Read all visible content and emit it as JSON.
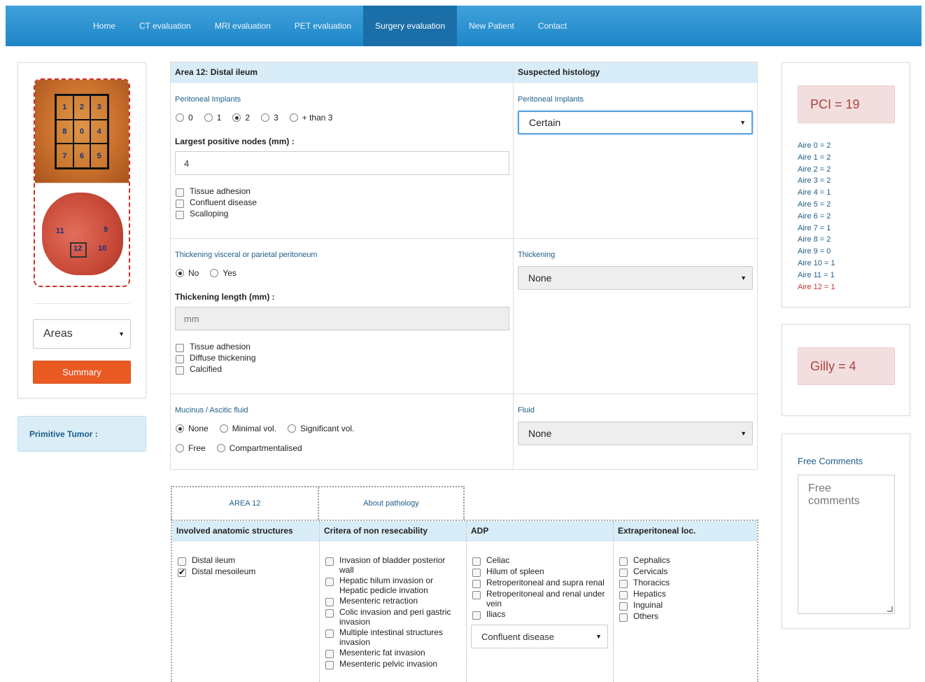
{
  "nav": {
    "items": [
      "Home",
      "CT evaluation",
      "MRI evaluation",
      "PET evaluation",
      "Surgery evaluation",
      "New Patient",
      "Contact"
    ],
    "active": "Surgery evaluation"
  },
  "left": {
    "areas_select": "Areas",
    "summary_button": "Summary",
    "primitive_tumor": "Primitive Tumor :",
    "abdomen_regions": [
      "1",
      "2",
      "3",
      "8",
      "0",
      "4",
      "7",
      "6",
      "5"
    ],
    "intestine_regions": [
      "11",
      "9",
      "12",
      "10"
    ]
  },
  "form": {
    "area_title": "Area 12: Distal ileum",
    "histology_title": "Suspected histology",
    "implants": {
      "label": "Peritoneal Implants",
      "options": [
        "0",
        "1",
        "2",
        "3",
        "+ than 3"
      ],
      "selected": "2",
      "nodes_label": "Largest positive nodes (mm) :",
      "nodes_value": "4",
      "checks": [
        {
          "label": "Tissue adhesion",
          "checked": false
        },
        {
          "label": "Confluent disease",
          "checked": false
        },
        {
          "label": "Scalloping",
          "checked": false
        }
      ],
      "hist_label": "Peritoneal Implants",
      "hist_value": "Certain"
    },
    "thickening": {
      "label": "Thickening visceral or parietal peritoneum",
      "options": [
        "No",
        "Yes"
      ],
      "selected": "No",
      "length_label": "Thickening length (mm) :",
      "length_placeholder": "mm",
      "checks": [
        {
          "label": "Tissue adhesion",
          "checked": false
        },
        {
          "label": "Diffuse thickening",
          "checked": false
        },
        {
          "label": "Calcified",
          "checked": false
        }
      ],
      "hist_label": "Thickening",
      "hist_value": "None"
    },
    "fluid": {
      "label": "Mucinus / Ascitic fluid",
      "options_row1": [
        "None",
        "Minimal vol.",
        "Significant vol."
      ],
      "options_row2": [
        "Free",
        "Compartmentalised"
      ],
      "selected": "None",
      "hist_label": "Fluid",
      "hist_value": "None"
    }
  },
  "bottom": {
    "tabs": [
      "AREA 12",
      "About pathology"
    ],
    "columns": [
      {
        "title": "Involved anatomic structures",
        "items": [
          {
            "label": "Distal ileum",
            "checked": false
          },
          {
            "label": "Distal mesoileum",
            "checked": true
          }
        ]
      },
      {
        "title": "Critera of non resecability",
        "items": [
          {
            "label": "Invasion of bladder posterior wall",
            "checked": false
          },
          {
            "label": "Hepatic hilum invasion or Hepatic pedicle invation",
            "checked": false
          },
          {
            "label": "Mesenteric retraction",
            "checked": false
          },
          {
            "label": "Colic invasion and peri gastric invasion",
            "checked": false
          },
          {
            "label": "Multiple intestinal structures invasion",
            "checked": false
          },
          {
            "label": "Mesenteric fat invasion",
            "checked": false
          },
          {
            "label": "Mesenteric pelvic invasion",
            "checked": false
          }
        ]
      },
      {
        "title": "ADP",
        "items": [
          {
            "label": "Celiac",
            "checked": false
          },
          {
            "label": "Hilum of spleen",
            "checked": false
          },
          {
            "label": "Retroperitoneal and supra renal",
            "checked": false
          },
          {
            "label": "Retroperitoneal and renal under vein",
            "checked": false
          },
          {
            "label": "Iliacs",
            "checked": false
          }
        ],
        "select_value": "Confluent disease"
      },
      {
        "title": "Extraperitoneal loc.",
        "items": [
          {
            "label": "Cephalics",
            "checked": false
          },
          {
            "label": "Cervicals",
            "checked": false
          },
          {
            "label": "Thoracics",
            "checked": false
          },
          {
            "label": "Hepatics",
            "checked": false
          },
          {
            "label": "Inguinal",
            "checked": false
          },
          {
            "label": "Others",
            "checked": false
          }
        ]
      }
    ]
  },
  "right": {
    "pci": "PCI = 19",
    "aires": [
      "Aire 0 = 2",
      "Aire 1 = 2",
      "Aire 2 = 2",
      "Aire 3 = 2",
      "Aire 4 = 1",
      "Aire 5 = 2",
      "Aire 6 = 2",
      "Aire 7 = 1",
      "Aire 8 = 2",
      "Aire 9 = 0",
      "Aire 10 = 1",
      "Aire 11 = 1",
      "Aire 12 = 1"
    ],
    "current_aire": "Aire 12 = 1",
    "gilly": "Gilly = 4",
    "free_comments_label": "Free Comments",
    "free_comments_placeholder": "Free comments"
  },
  "colors": {
    "nav_bg": "#2b93d1",
    "nav_active": "#1a6fa8",
    "header_bg": "#d9edf8",
    "summary_button": "#ea5a23",
    "score_bg": "#f2dede",
    "score_text": "#a94442",
    "label_blue": "#1d5e8a"
  }
}
